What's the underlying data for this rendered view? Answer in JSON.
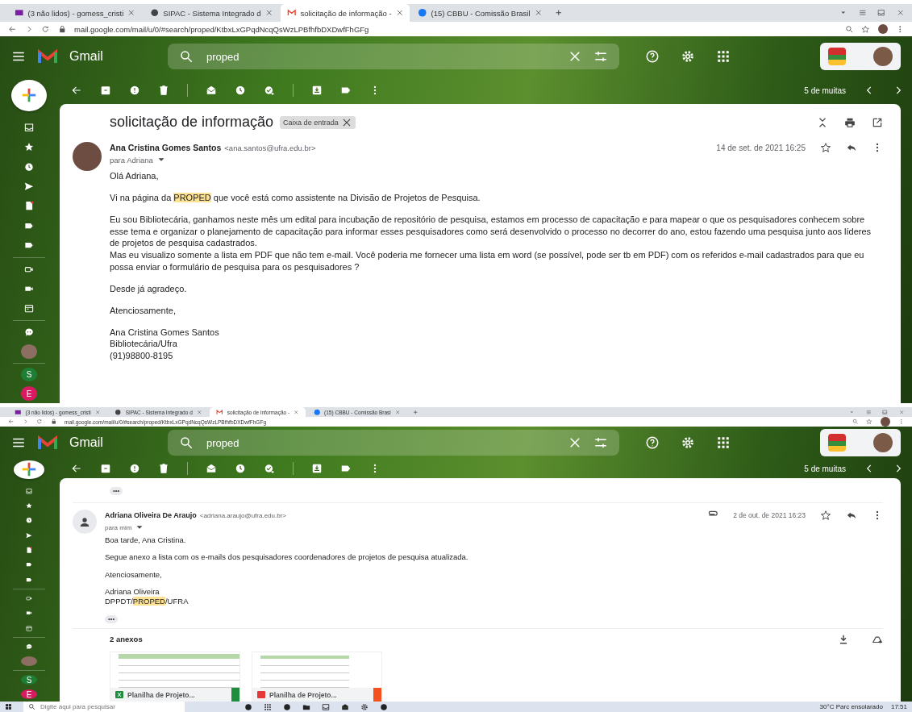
{
  "windows": [
    {
      "kind": "full",
      "tabs": [
        {
          "label": "(3 não lidos) - gomess_cristi",
          "selected": false
        },
        {
          "label": "SIPAC - Sistema Integrado d",
          "selected": false
        },
        {
          "label": "solicitação de informação - ",
          "selected": true
        },
        {
          "label": "(15) CBBU - Comissão Brasil",
          "selected": false
        }
      ],
      "url": "mail.google.com/mail/u/0/#search/proped/KtbxLxGPqdNcqQsWzLPBfhfbDXDwfFhGFg",
      "app_name": "Gmail",
      "search": {
        "value": "proped"
      },
      "pager": "5 de muitas",
      "sidebar": {
        "avatars": [
          {
            "letter": "S",
            "color": "#1e7e34"
          },
          {
            "letter": "E",
            "color": "#d81b60"
          }
        ]
      },
      "thread": {
        "subject": "solicitação de informação",
        "label": "Caixa de entrada"
      },
      "message": {
        "sender": "Ana Cristina Gomes Santos",
        "email": "<ana.santos@ufra.edu.br>",
        "to": "para Adriana",
        "date": "14 de set. de 2021 16:25",
        "attachment_clip": false,
        "photo": true,
        "paragraphs": [
          [
            "Olá Adriana,"
          ],
          [
            "Vi na página da **PROPED** que você está como assistente na Divisão de Projetos de Pesquisa."
          ],
          [
            "Eu sou Bibliotecária, ganhamos neste mês um edital para incubação de repositório de pesquisa, estamos em processo de capacitação e para mapear o que os pesquisadores conhecem sobre esse tema e organizar o planejamento de capacitação para informar esses pesquisadores como será desenvolvido o processo no decorrer do ano, estou fazendo uma pesquisa junto aos líderes de projetos de pesquisa cadastrados.",
            "Mas eu visualizo somente a lista em PDF que não tem e-mail. Você poderia me fornecer uma lista em word (se possível, pode ser tb em PDF) com os referidos e-mail cadastrados para que eu possa enviar o formulário de pesquisa para os  pesquisadores ?"
          ],
          [
            "Desde já agradeço."
          ],
          [
            "Atenciosamente,"
          ],
          [
            "Ana Cristina Gomes Santos",
            "Bibliotecária/Ufra",
            "(91)98800-8195"
          ]
        ]
      }
    },
    {
      "kind": "compact",
      "tabs": [
        {
          "label": "(3 não lidos) - gomess_cristi",
          "selected": false
        },
        {
          "label": "SIPAC - Sistema Integrado d",
          "selected": false
        },
        {
          "label": "solicitação de informação - ",
          "selected": true
        },
        {
          "label": "(15) CBBU - Comissão Brasi",
          "selected": false
        }
      ],
      "url": "mail.google.com/mail/u/0/#search/proped/KtbxLxGPqdNcqQsWzLPBfhfbDXDwfFhGFg",
      "app_name": "Gmail",
      "search": {
        "value": "proped"
      },
      "pager": "5 de muitas",
      "sidebar": {
        "avatars": [
          {
            "letter": "S",
            "color": "#1e7e34"
          },
          {
            "letter": "E",
            "color": "#d81b60"
          }
        ]
      },
      "thread": {
        "hidden_messages": "•••"
      },
      "message": {
        "sender": "Adriana Oliveira De Araujo",
        "email": "<adriana.araujo@ufra.edu.br>",
        "to": "para mim",
        "date": "2 de out. de 2021 16:23",
        "attachment_clip": true,
        "photo": false,
        "paragraphs": [
          [
            "Boa tarde, Ana Cristina."
          ],
          [
            "Segue anexo a lista com os e-mails dos pesquisadores coordenadores de projetos de pesquisa atualizada."
          ],
          [
            "Atenciosamente,"
          ],
          [
            "Adriana Oliveira",
            "DPPDT/**PROPED**/UFRA"
          ]
        ],
        "trimmed_content": "•••",
        "attachments": {
          "title": "2 anexos",
          "files": [
            {
              "kind": "sheet",
              "name": "Planilha de Projeto..."
            },
            {
              "kind": "pdf",
              "name": "Planilha de Projeto..."
            }
          ]
        }
      }
    }
  ],
  "taskbar": {
    "search": {
      "placeholder": "Digite aqui para pesquisar"
    },
    "weather": "30°C  Parc ensolarado",
    "time": "17:51"
  }
}
